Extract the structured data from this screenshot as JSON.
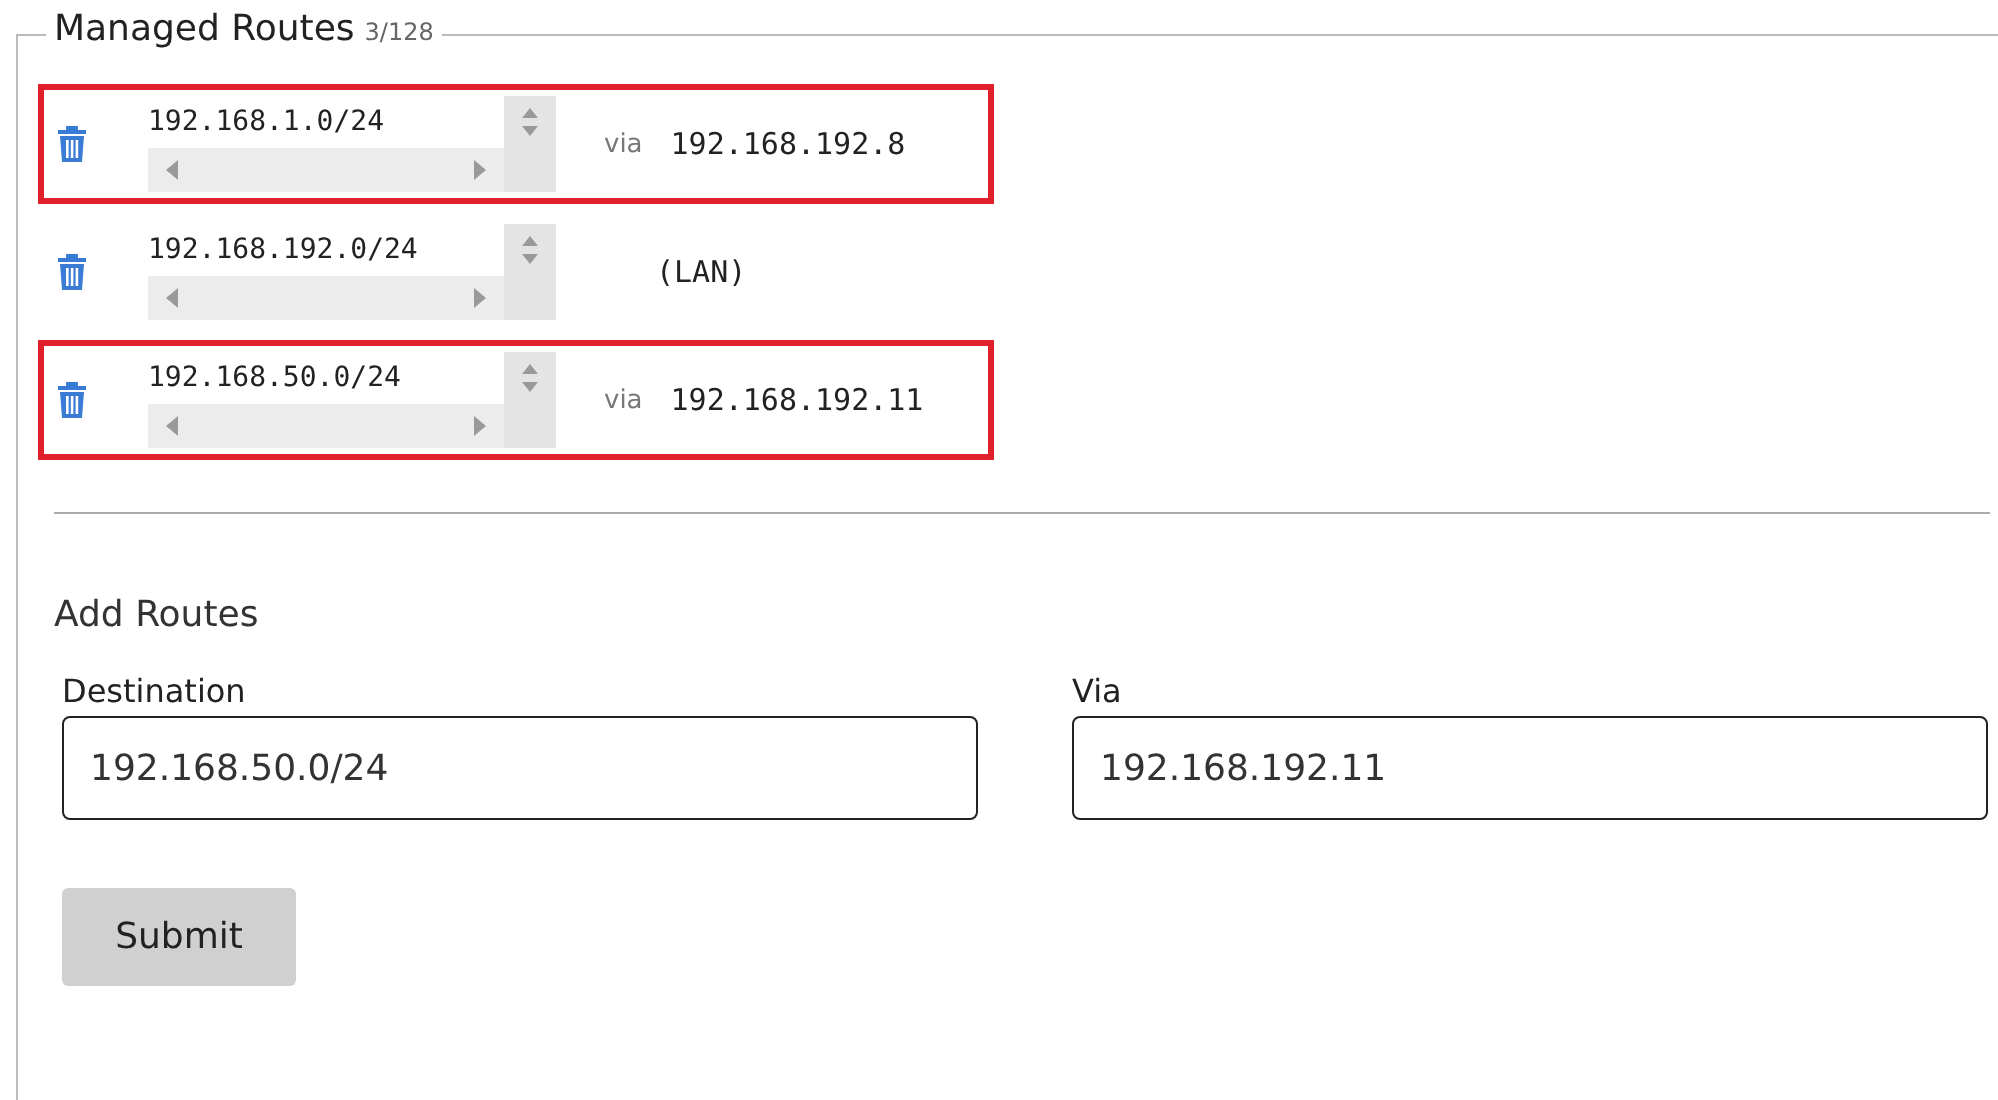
{
  "managed_routes": {
    "title": "Managed Routes",
    "count": "3/128",
    "routes": [
      {
        "kind": "via",
        "destination": "192.168.1.0/24",
        "via_label": "via",
        "gateway": "192.168.192.8",
        "highlighted": true
      },
      {
        "kind": "lan",
        "destination": "192.168.192.0/24",
        "gateway": "(LAN)",
        "highlighted": false
      },
      {
        "kind": "via",
        "destination": "192.168.50.0/24",
        "via_label": "via",
        "gateway": "192.168.192.11",
        "highlighted": true
      }
    ]
  },
  "add_routes": {
    "title": "Add Routes",
    "fields": [
      {
        "label": "Destination",
        "value": "192.168.50.0/24"
      },
      {
        "label": "Via",
        "value": "192.168.192.11"
      }
    ],
    "submit": "Submit"
  }
}
